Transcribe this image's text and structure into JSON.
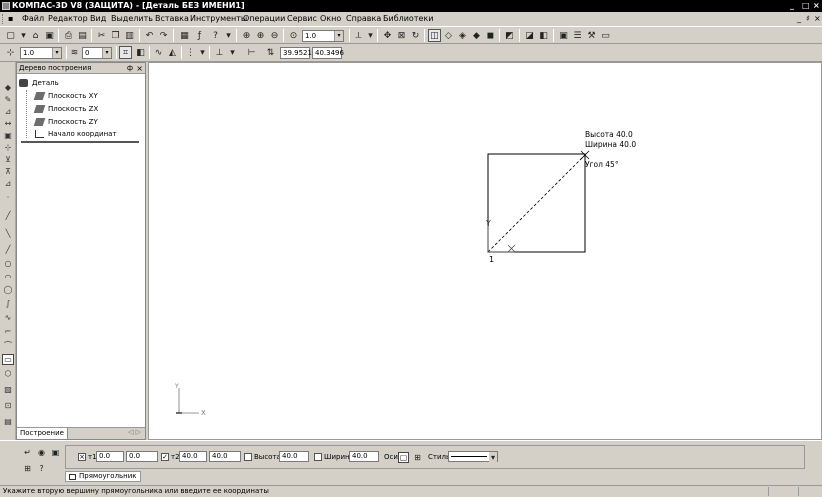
{
  "window": {
    "title": "КОМПАС-3D V8 (ЗАЩИТА) - [Деталь БЕЗ ИМЕНИ1]",
    "controls": [
      "_",
      "□",
      "×"
    ]
  },
  "menu": {
    "items": [
      "Файл",
      "Редактор",
      "Вид",
      "Выделить",
      "Вставка",
      "Инструменты",
      "Операции",
      "Сервис",
      "Окно",
      "Справка",
      "Библиотеки"
    ],
    "mdi_controls": [
      "_",
      "♯",
      "×"
    ]
  },
  "toolbar1": {
    "zoom_value": "1.0",
    "icons": [
      "new-icon",
      "open-icon",
      "save-icon",
      "print-icon",
      "preview-icon",
      "cut-icon",
      "copy-icon",
      "paste-icon",
      "undo-icon",
      "redo-icon",
      "manager-icon",
      "fx-icon",
      "help-pointer-icon",
      "zoom-window-icon",
      "zoom-in-icon",
      "zoom-out-icon",
      "zoom-scale-icon",
      "zoom-combo",
      "orient-icon",
      "pan-icon",
      "fit-icon",
      "rotate-icon",
      "shaded-icon",
      "wireframe-icon",
      "hidden-icon",
      "shade-icon",
      "perspective-icon",
      "section-icon",
      "render-icon",
      "library-icon",
      "properties-icon",
      "measure-icon"
    ]
  },
  "toolbar2": {
    "line_weight": "1.0",
    "layer_value": "0",
    "coord_x": "39.9521",
    "coord_y": "40.3496"
  },
  "tree": {
    "header": "Дерево построения",
    "pin": "ф",
    "close": "×",
    "items": [
      {
        "label": "Деталь",
        "icon": "part-icon"
      },
      {
        "label": "Плоскость XY",
        "icon": "plane-icon"
      },
      {
        "label": "Плоскость ZX",
        "icon": "plane-icon"
      },
      {
        "label": "Плоскость ZY",
        "icon": "plane-icon"
      },
      {
        "label": "Начало координат",
        "icon": "origin-icon"
      }
    ],
    "tab": "Построение",
    "nav": "◁ ▷"
  },
  "canvas": {
    "label_height": "Высота 40.0",
    "label_width": "Ширина 40.0",
    "label_angle": "Угол 45°",
    "axis_y": "Y",
    "axis_x": "X",
    "point_label": "1",
    "corner_axis_y": "Y",
    "corner_axis_x": "X"
  },
  "properties": {
    "t1_label": "т1",
    "t1_x": "0.0",
    "t1_y": "0.0",
    "t2_label": "т2",
    "t2_x": "40.0",
    "t2_y": "40.0",
    "height_label": "Высота",
    "height_value": "40.0",
    "width_label": "Ширина",
    "width_value": "40.0",
    "axes_label": "Оси",
    "style_label": "Стиль",
    "bottom_tab": "Прямоугольник"
  },
  "status": {
    "message": "Укажите вторую вершину прямоугольника или введите ее координаты"
  }
}
